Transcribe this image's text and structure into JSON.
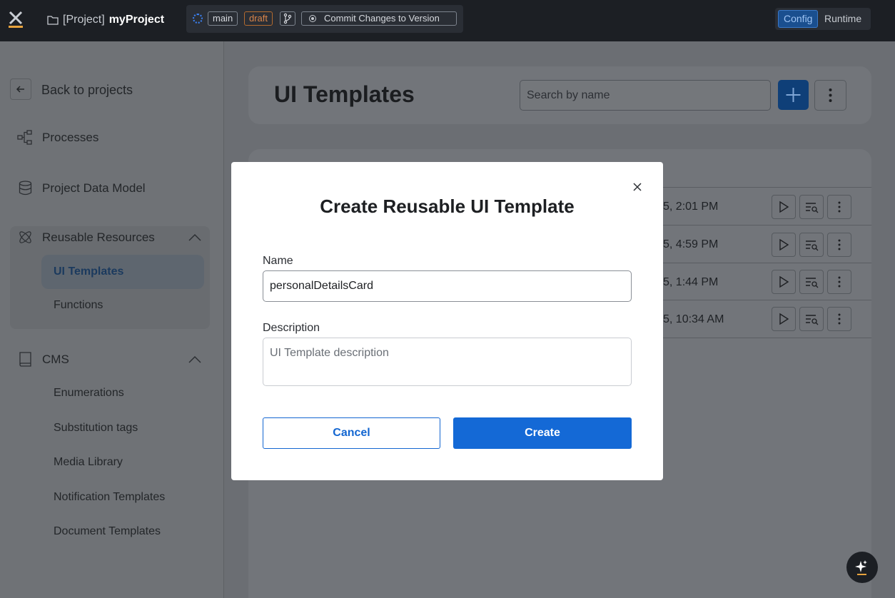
{
  "topbar": {
    "project_prefix": "[Project]",
    "project_name": "myProject",
    "branch": "main",
    "status": "draft",
    "commit_label": "Commit Changes to Version",
    "mode_config": "Config",
    "mode_runtime": "Runtime",
    "icons": [
      "logo-icon",
      "folder-icon",
      "sync-icon",
      "branch-icon",
      "record-icon"
    ]
  },
  "sidebar": {
    "back_label": "Back to projects",
    "processes": "Processes",
    "data_model": "Project Data Model",
    "reusable": {
      "label": "Reusable Resources",
      "items": [
        "UI Templates",
        "Functions"
      ]
    },
    "cms": {
      "label": "CMS",
      "items": [
        "Enumerations",
        "Substitution tags",
        "Media Library",
        "Notification Templates",
        "Document Templates"
      ]
    }
  },
  "main": {
    "title": "UI Templates",
    "search_placeholder": "Search by name",
    "rows": [
      {
        "date": "5, 2:01 PM"
      },
      {
        "date": "5, 4:59 PM"
      },
      {
        "date": "5, 1:44 PM"
      },
      {
        "date": "5, 10:34 AM"
      }
    ]
  },
  "modal": {
    "title": "Create Reusable UI Template",
    "name_label": "Name",
    "name_value": "personalDetailsCard",
    "description_label": "Description",
    "description_placeholder": "UI Template description",
    "cancel_label": "Cancel",
    "create_label": "Create"
  },
  "colors": {
    "primary": "#1469d6",
    "topbar": "#1c1f24",
    "draft": "#d9854a",
    "accent_logo": "#e8a33d"
  }
}
